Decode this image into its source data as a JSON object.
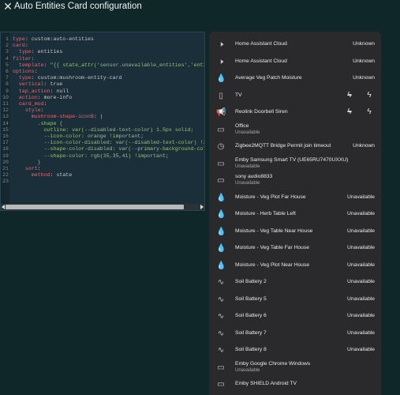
{
  "header": {
    "close_icon": "close-icon",
    "title": "Auto Entities Card configuration"
  },
  "editor": {
    "lines": [
      {
        "n": "1",
        "t": [
          [
            "k",
            "type"
          ],
          [
            "p",
            ": custom:auto-entities"
          ]
        ]
      },
      {
        "n": "2",
        "t": [
          [
            "k",
            "card"
          ],
          [
            "p",
            ":"
          ]
        ]
      },
      {
        "n": "3",
        "t": [
          [
            "p",
            "  "
          ],
          [
            "k",
            "type"
          ],
          [
            "p",
            ": entities"
          ]
        ]
      },
      {
        "n": "4",
        "t": [
          [
            "k",
            "filter"
          ],
          [
            "p",
            ":"
          ]
        ]
      },
      {
        "n": "5",
        "t": [
          [
            "p",
            "  "
          ],
          [
            "k",
            "template"
          ],
          [
            "p",
            ": "
          ],
          [
            "s",
            "\"{{ state_attr('sensor.unavailable_entities','entity_"
          ]
        ]
      },
      {
        "n": "6",
        "t": [
          [
            "k",
            "options"
          ],
          [
            "p",
            ":"
          ]
        ]
      },
      {
        "n": "7",
        "t": [
          [
            "p",
            "  "
          ],
          [
            "k",
            "type"
          ],
          [
            "p",
            ": custom:mushroom-entity-card"
          ]
        ]
      },
      {
        "n": "8",
        "t": [
          [
            "p",
            "  "
          ],
          [
            "k",
            "vertical"
          ],
          [
            "p",
            ": true"
          ]
        ]
      },
      {
        "n": "9",
        "t": [
          [
            "p",
            "  "
          ],
          [
            "k",
            "tap_action"
          ],
          [
            "p",
            ": null"
          ]
        ]
      },
      {
        "n": "10",
        "t": [
          [
            "p",
            "  "
          ],
          [
            "k",
            "action"
          ],
          [
            "p",
            ": more-info"
          ]
        ]
      },
      {
        "n": "11",
        "t": [
          [
            "p",
            "  "
          ],
          [
            "k",
            "card_mod"
          ],
          [
            "p",
            ":"
          ]
        ]
      },
      {
        "n": "12",
        "t": [
          [
            "p",
            "    "
          ],
          [
            "k",
            "style"
          ],
          [
            "p",
            ":"
          ]
        ]
      },
      {
        "n": "13",
        "t": [
          [
            "p",
            "      "
          ],
          [
            "k",
            "mushroom-shape-icon$"
          ],
          [
            "p",
            ": |"
          ]
        ]
      },
      {
        "n": "14",
        "t": [
          [
            "p",
            "        "
          ],
          [
            "s",
            ".shape {"
          ]
        ]
      },
      {
        "n": "15",
        "t": [
          [
            "p",
            "          "
          ],
          [
            "s",
            "outline: var(--disabled-text-color) 1.5px solid;"
          ]
        ]
      },
      {
        "n": "16",
        "t": [
          [
            "p",
            "          "
          ],
          [
            "s",
            "--icon-color: orange !important;"
          ]
        ]
      },
      {
        "n": "17",
        "t": [
          [
            "p",
            "          "
          ],
          [
            "s",
            "--icon-color-disabled: var(--disabled-text-color) !imp"
          ]
        ]
      },
      {
        "n": "18",
        "t": [
          [
            "p",
            "          "
          ],
          [
            "s",
            "--shape-color-disabled: var(--primary-background-color"
          ]
        ]
      },
      {
        "n": "19",
        "t": [
          [
            "p",
            "          "
          ],
          [
            "s",
            "--shape-color: rgb(35,35,41) !important;"
          ]
        ]
      },
      {
        "n": "20",
        "t": [
          [
            "p",
            "        "
          ],
          [
            "s",
            "}"
          ]
        ]
      },
      {
        "n": "21",
        "t": [
          [
            "p",
            "    "
          ],
          [
            "k",
            "sort"
          ],
          [
            "p",
            ":"
          ]
        ]
      },
      {
        "n": "22",
        "t": [
          [
            "p",
            "      "
          ],
          [
            "k",
            "method"
          ],
          [
            "p",
            ": state"
          ]
        ]
      },
      {
        "n": "23",
        "t": [
          [
            "p",
            ""
          ]
        ]
      }
    ]
  },
  "entities": [
    {
      "icon": "speaker-off-icon",
      "name": "Home Assistant Cloud",
      "sub": "",
      "state": "Unknown"
    },
    {
      "icon": "speaker-off-icon",
      "name": "Home Assistant Cloud",
      "sub": "",
      "state": "Unknown"
    },
    {
      "icon": "water-drop-icon",
      "name": "Average Veg Patch Moisture",
      "sub": "",
      "state": "Unknown"
    },
    {
      "icon": "remote-icon",
      "name": "TV",
      "sub": "",
      "state": "",
      "buttons": [
        "flash-off-icon",
        "flash-icon"
      ]
    },
    {
      "icon": "bullhorn-icon",
      "name": "Reolink Doorbell Siren",
      "sub": "",
      "state": "",
      "buttons": [
        "flash-off-icon",
        "flash-icon"
      ]
    },
    {
      "icon": "cast-icon",
      "name": "Office",
      "sub": "Unavailable",
      "state": ""
    },
    {
      "icon": "clock-icon",
      "name": "Zigbee2MQTT Bridge Permit join timeout",
      "sub": "",
      "state": "Unknown"
    },
    {
      "icon": "cast-icon",
      "name": "Emby Samsung Smart TV (UE65RU7470UXXU)",
      "sub": "Unavailable",
      "state": ""
    },
    {
      "icon": "cast-icon",
      "name": "sony audio8833",
      "sub": "Unavailable",
      "state": ""
    },
    {
      "icon": "water-drop-icon",
      "name": "Moisture - Veg Plot Far House",
      "sub": "",
      "state": "Unavailable"
    },
    {
      "icon": "water-drop-icon",
      "name": "Moisture - Herb Table Left",
      "sub": "",
      "state": "Unavailable"
    },
    {
      "icon": "water-drop-icon",
      "name": "Moisture - Veg Table Near House",
      "sub": "",
      "state": "Unavailable"
    },
    {
      "icon": "water-drop-icon",
      "name": "Moisture - Veg Table Far House",
      "sub": "",
      "state": "Unavailable"
    },
    {
      "icon": "water-drop-icon",
      "name": "Moisture - Veg Plot Near House",
      "sub": "",
      "state": "Unavailable"
    },
    {
      "icon": "sine-wave-icon",
      "name": "Soil Battery 2",
      "sub": "",
      "state": "Unavailable"
    },
    {
      "icon": "sine-wave-icon",
      "name": "Soil Battery 5",
      "sub": "",
      "state": "Unavailable"
    },
    {
      "icon": "sine-wave-icon",
      "name": "Soil Battery 6",
      "sub": "",
      "state": "Unavailable"
    },
    {
      "icon": "sine-wave-icon",
      "name": "Soil Battery 7",
      "sub": "",
      "state": "Unavailable"
    },
    {
      "icon": "sine-wave-icon",
      "name": "Soil Battery 8",
      "sub": "",
      "state": "Unavailable"
    },
    {
      "icon": "cast-icon",
      "name": "Emby Google Chrome Windows",
      "sub": "Unavailable",
      "state": ""
    },
    {
      "icon": "cast-icon",
      "name": "Emby SHIELD Android TV",
      "sub": "",
      "state": ""
    }
  ]
}
